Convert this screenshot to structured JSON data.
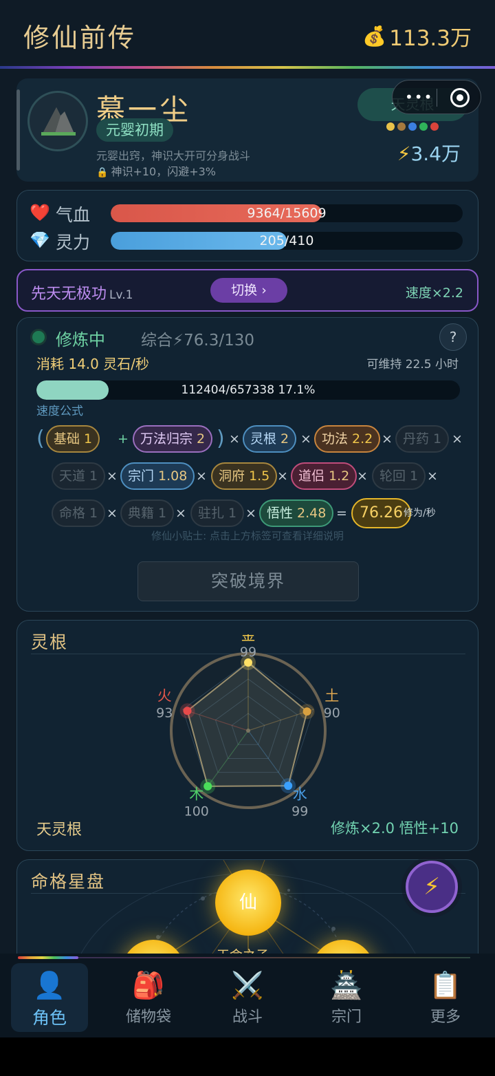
{
  "app": {
    "title": "修仙前传",
    "money": "113.3万",
    "money_icon": "money-bag-icon"
  },
  "capsule": {
    "dots": "•••"
  },
  "profile": {
    "name": "慕一尘",
    "realm": "元婴初期",
    "realm_desc": "元婴出窍，神识大开可分身战斗",
    "realm_bonus": "神识+10，闪避+3%",
    "spirit_root_badge": "天灵根",
    "root_dot_colors": [
      "#e8c24a",
      "#a57a3e",
      "#3b7fe0",
      "#2fb35a",
      "#d8443b"
    ],
    "power": "3.4万"
  },
  "stats": {
    "hp": {
      "label": "气血",
      "text": "9364/15609",
      "current": 9364,
      "max": 15609,
      "color": "#d9574a"
    },
    "mp": {
      "label": "灵力",
      "text": "205/410",
      "current": 205,
      "max": 410,
      "color": "#4a9fdc"
    }
  },
  "technique": {
    "name": "先天无极功",
    "level": "Lv.1",
    "switch_label": "切换 ›",
    "speed": "速度×2.2"
  },
  "cultivation": {
    "status": "修炼中",
    "overall": "综合⚡76.3/130",
    "help": "?",
    "consume": "消耗 14.0 灵石/秒",
    "sustain": "可维持 22.5 小时",
    "progress_text": "112404/657338  17.1%",
    "progress": 0.171,
    "formula_label": "速度公式",
    "formula": {
      "base": {
        "label": "基础",
        "value": "1"
      },
      "wanfa": {
        "label": "万法归宗",
        "value": "2"
      },
      "linggen": {
        "label": "灵根",
        "value": "2"
      },
      "gongfa": {
        "label": "功法",
        "value": "2.2"
      },
      "danyao": {
        "label": "丹药",
        "value": "1"
      },
      "tiandao": {
        "label": "天道",
        "value": "1"
      },
      "zongmen": {
        "label": "宗门",
        "value": "1.08"
      },
      "dongfu": {
        "label": "洞府",
        "value": "1.5"
      },
      "daolv": {
        "label": "道侣",
        "value": "1.2"
      },
      "lunhui": {
        "label": "轮回",
        "value": "1"
      },
      "mingge": {
        "label": "命格",
        "value": "1"
      },
      "dianji": {
        "label": "典籍",
        "value": "1"
      },
      "zhuzha": {
        "label": "驻扎",
        "value": "1"
      },
      "wuxing": {
        "label": "悟性",
        "value": "2.48"
      },
      "result": "76.26",
      "unit": "修为/秒"
    },
    "tip": "修仙小贴士: 点击上方标签可查看详细说明",
    "break_button": "突破境界"
  },
  "spirit_root": {
    "title": "灵根",
    "elements": [
      {
        "name": "金",
        "value": 99,
        "color": "#f0c64a",
        "dot": "#ffe066"
      },
      {
        "name": "土",
        "value": 90,
        "color": "#e0a850",
        "dot": "#d8a040"
      },
      {
        "name": "水",
        "value": 99,
        "color": "#4a9fe8",
        "dot": "#3aa0ff"
      },
      {
        "name": "木",
        "value": 100,
        "color": "#4fcf68",
        "dot": "#4ade5a"
      },
      {
        "name": "火",
        "value": 93,
        "color": "#e2564a",
        "dot": "#e84a4a"
      }
    ],
    "max": 100,
    "type_name": "天灵根",
    "bonus": "修炼×2.0  悟性+10"
  },
  "fate": {
    "title": "命格星盘",
    "center_node": "仙",
    "label": "天命之子"
  },
  "nav": {
    "items": [
      {
        "label": "角色",
        "icon": "person-icon",
        "glyph": "👤"
      },
      {
        "label": "储物袋",
        "icon": "backpack-icon",
        "glyph": "🎒"
      },
      {
        "label": "战斗",
        "icon": "crossed-swords-icon",
        "glyph": "⚔️"
      },
      {
        "label": "宗门",
        "icon": "pagoda-icon",
        "glyph": "🏯"
      },
      {
        "label": "更多",
        "icon": "clipboard-icon",
        "glyph": "📋"
      }
    ],
    "active": 0
  }
}
